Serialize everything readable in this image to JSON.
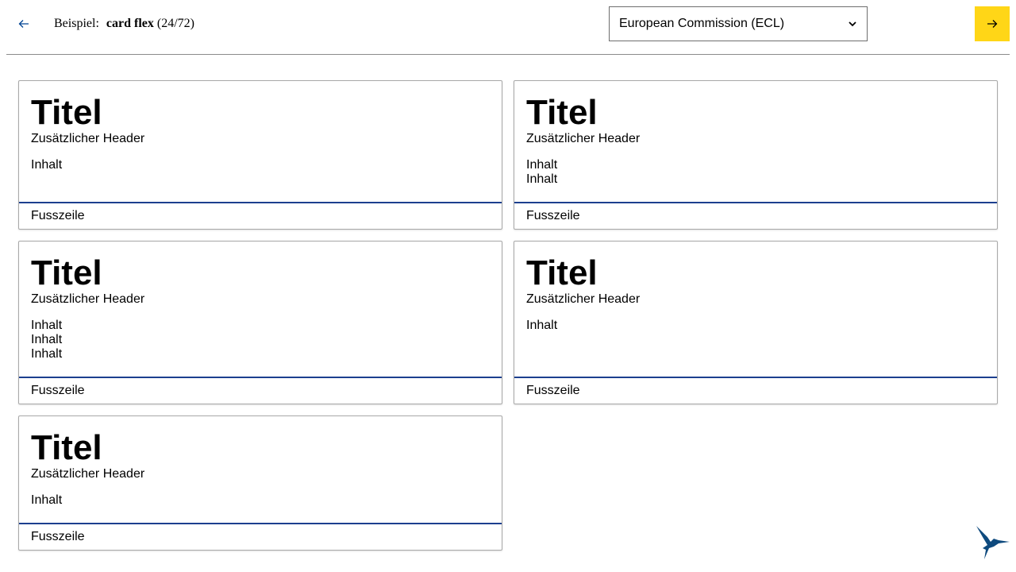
{
  "nav": {
    "back_icon": "arrow-left-icon",
    "example_prefix": "Beispiel:",
    "example_name": "card flex",
    "example_counter": "(24/72)",
    "next_icon": "arrow-right-icon",
    "next_button_color": "#ffd617",
    "back_icon_color": "#004494"
  },
  "theme_select": {
    "selected": "European Commission (ECL)",
    "icon": "chevron-down-icon"
  },
  "cards": [
    {
      "title": "Titel",
      "subtitle": "Zusätzlicher Header",
      "content": [
        "Inhalt"
      ],
      "footer": "Fusszeile"
    },
    {
      "title": "Titel",
      "subtitle": "Zusätzlicher Header",
      "content": [
        "Inhalt",
        "Inhalt"
      ],
      "footer": "Fusszeile"
    },
    {
      "title": "Titel",
      "subtitle": "Zusätzlicher Header",
      "content": [
        "Inhalt",
        "Inhalt",
        "Inhalt"
      ],
      "footer": "Fusszeile"
    },
    {
      "title": "Titel",
      "subtitle": "Zusätzlicher Header",
      "content": [
        "Inhalt"
      ],
      "footer": "Fusszeile"
    },
    {
      "title": "Titel",
      "subtitle": "Zusätzlicher Header",
      "content": [
        "Inhalt"
      ],
      "footer": "Fusszeile"
    }
  ],
  "colors": {
    "card_footer_border": "#1c3f8f",
    "logo": "#0e4a7e"
  },
  "logo_icon": "hummingbird-logo-icon"
}
